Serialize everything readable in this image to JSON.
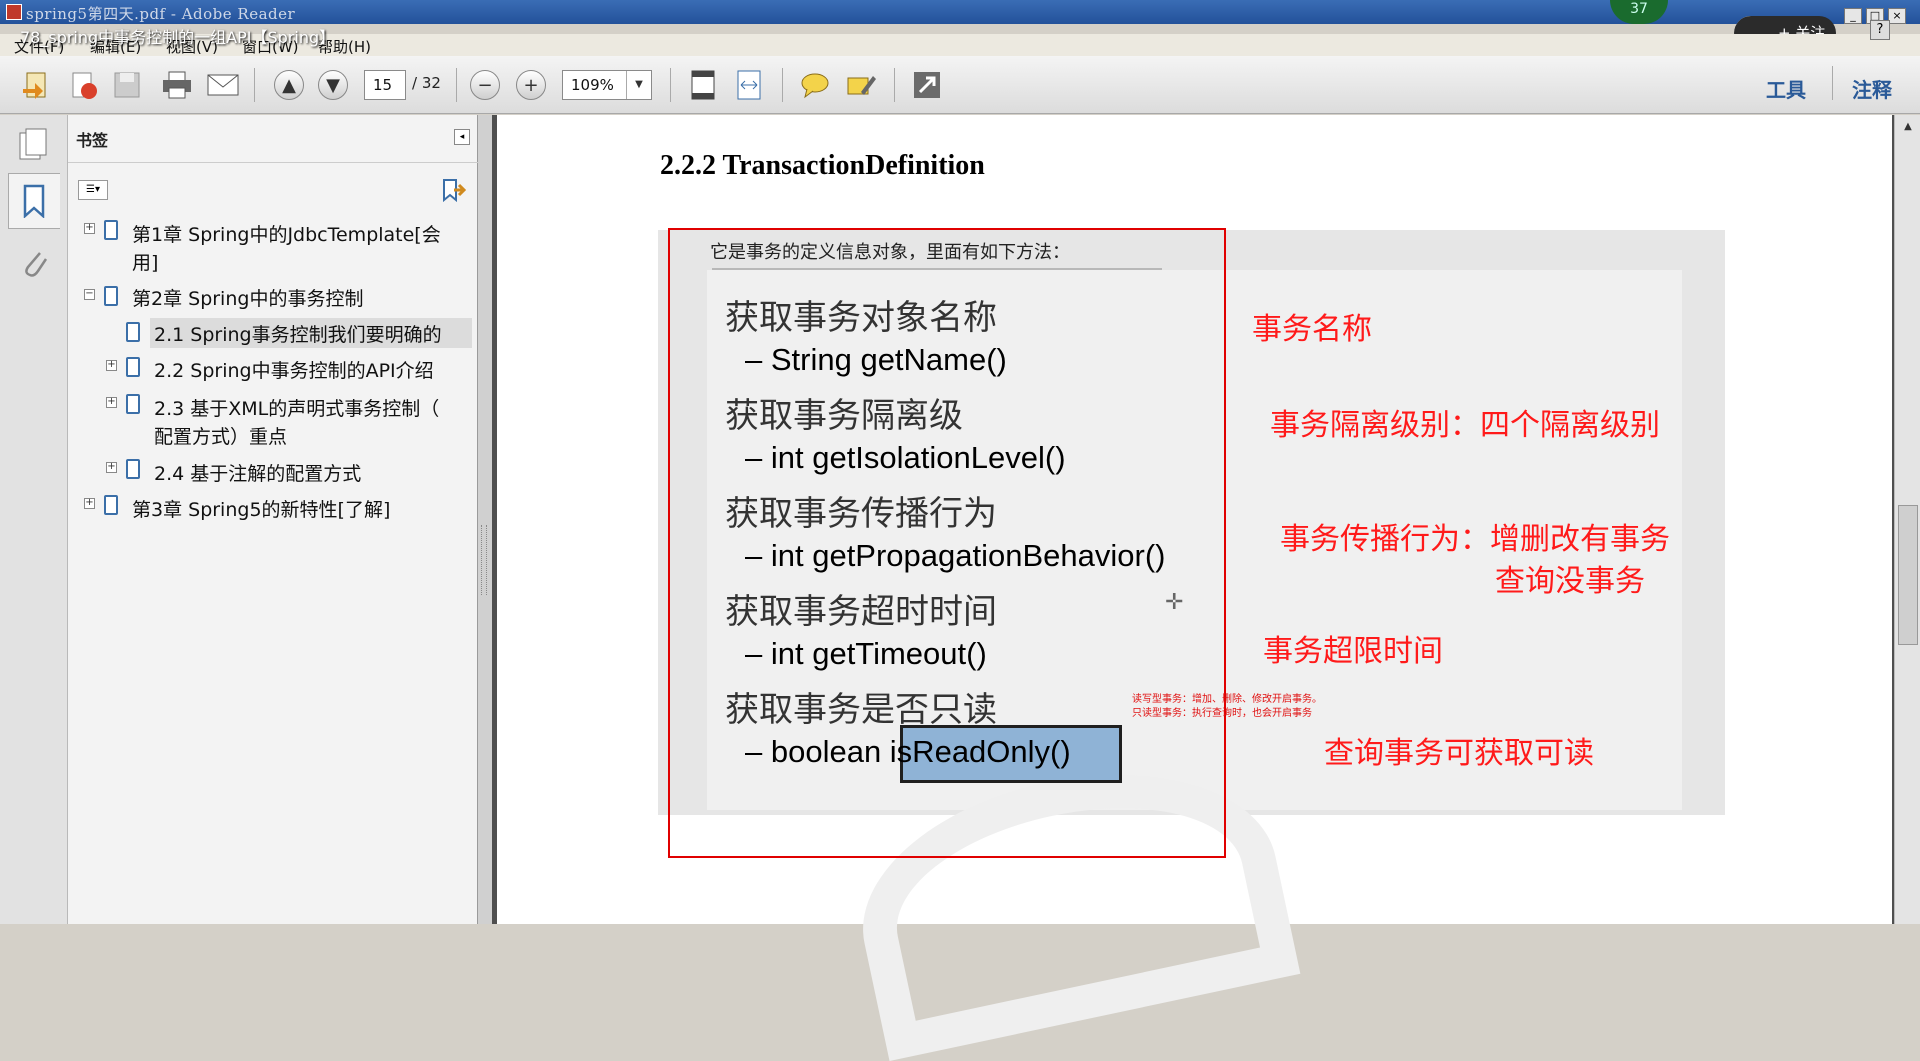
{
  "window": {
    "title": "spring5第四天.pdf - Adobe Reader"
  },
  "video_title": "78_spring中事务控制的一组API【Spring】",
  "badge_count": "37",
  "follow_label": "+ 关注",
  "help_label": "?",
  "menu": [
    "文件(F)",
    "编辑(E)",
    "视图(V)",
    "窗口(W)",
    "帮助(H)"
  ],
  "toolbar": {
    "page_current": "15",
    "page_total": "/ 32",
    "zoom": "109%",
    "tools_label": "工具",
    "comments_label": "注释"
  },
  "bookmarks": {
    "header": "书签",
    "items": [
      {
        "label": "第1章 Spring中的JdbcTemplate[会",
        "label2": "用]",
        "expander": "+"
      },
      {
        "label": "第2章 Spring中的事务控制",
        "expander": "−"
      },
      {
        "label": "2.1 Spring事务控制我们要明确的"
      },
      {
        "label": "2.2 Spring中事务控制的API介绍",
        "expander": "+"
      },
      {
        "label": "2.3 基于XML的声明式事务控制（",
        "label2": "配置方式）重点",
        "expander": "+"
      },
      {
        "label": "2.4 基于注解的配置方式",
        "expander": "+"
      },
      {
        "label": "第3章 Spring5的新特性[了解]",
        "expander": "+"
      }
    ]
  },
  "document": {
    "heading": "2.2.2    TransactionDefinition",
    "intro": "它是事务的定义信息对象，里面有如下方法：",
    "slide_lines": [
      "获取事务对象名称",
      "– String getName()",
      "获取事务隔离级",
      "– int getIsolationLevel()",
      "获取事务传播行为",
      "– int getPropagationBehavior()",
      "获取事务超时时间",
      "– int getTimeout()",
      "获取事务是否只读",
      "– boolean isReadOnly()"
    ],
    "highlight": "isReadOnly()",
    "tiny_notes": [
      "读写型事务：增加、删除、修改开启事务。",
      "只读型事务：执行查询时，也会开启事务"
    ],
    "annotations": [
      "事务名称",
      "事务隔离级别：四个隔离级别",
      "事务传播行为：增删改有事务",
      "查询没事务",
      "事务超限时间",
      "查询事务可获取可读"
    ]
  },
  "colors": {
    "annotation": "#ff1a1a",
    "highlight": "#8fb3d6",
    "titlebar": "#23519a"
  }
}
